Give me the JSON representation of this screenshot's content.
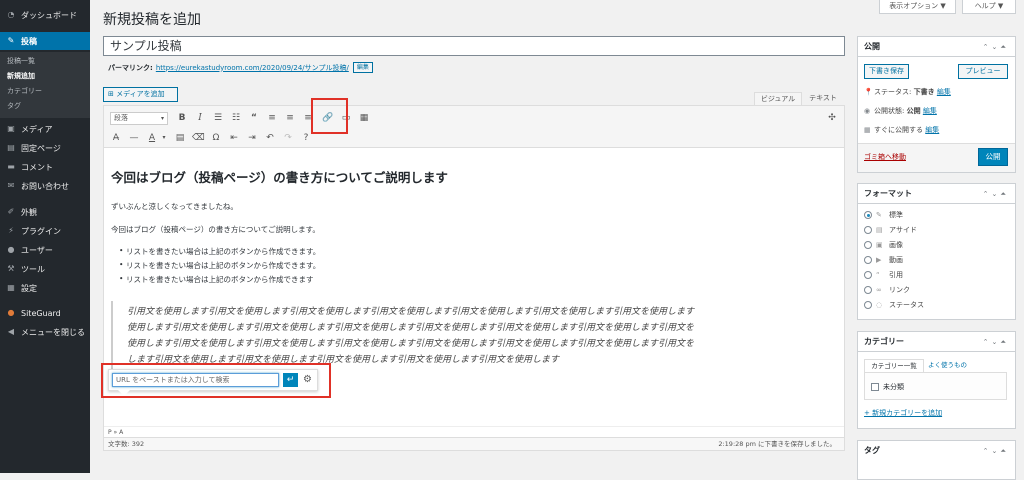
{
  "sidebar": {
    "items": [
      {
        "label": "ダッシュボード",
        "icon": "dashboard-icon"
      },
      {
        "label": "投稿",
        "icon": "pin-icon"
      },
      {
        "label": "メディア",
        "icon": "media-icon"
      },
      {
        "label": "固定ページ",
        "icon": "page-icon"
      },
      {
        "label": "コメント",
        "icon": "comment-icon"
      },
      {
        "label": "お問い合わせ",
        "icon": "mail-icon"
      },
      {
        "label": "外観",
        "icon": "brush-icon"
      },
      {
        "label": "プラグイン",
        "icon": "plugin-icon"
      },
      {
        "label": "ユーザー",
        "icon": "user-icon"
      },
      {
        "label": "ツール",
        "icon": "wrench-icon"
      },
      {
        "label": "設定",
        "icon": "settings-icon"
      },
      {
        "label": "SiteGuard",
        "icon": "siteguard-icon"
      },
      {
        "label": "メニューを閉じる",
        "icon": "collapse-icon"
      }
    ],
    "submenu": [
      "投稿一覧",
      "新規追加",
      "カテゴリー",
      "タグ"
    ]
  },
  "screen_options": "表示オプション ▼",
  "help": "ヘルプ ▼",
  "page_title": "新規投稿を追加",
  "post_title": "サンプル投稿",
  "permalink": {
    "label": "パーマリンク:",
    "url": "https://eurekastudyroom.com/2020/09/24/サンプル投稿/",
    "edit": "編集"
  },
  "add_media": "メディアを追加",
  "editor_tabs": {
    "visual": "ビジュアル",
    "text": "テキスト"
  },
  "toolbar": {
    "format": "段落"
  },
  "content": {
    "heading": "今回はブログ（投稿ページ）の書き方についてご説明します",
    "p1": "ずいぶんと涼しくなってきましたね。",
    "p2": "今回はブログ（投稿ページ）の書き方についてご説明します。",
    "list": [
      "リストを書きたい場合は上記のボタンから作成できます。",
      "リストを書きたい場合は上記のボタンから作成できます。",
      "リストを書きたい場合は上記のボタンから作成できます"
    ],
    "quote": [
      "引用文を使用します引用文を使用します引用文を使用します引用文を使用します引用文を使用します引用文を使用します引用文を使用します",
      "使用します引用文を使用します引用文を使用します引用文を使用します引用文を使用します引用文を使用します引用文を使用します引用文を",
      "使用します引用文を使用します引用文を使用します引用文を使用します引用文を使用します引用文を使用します引用文を使用します引用文を",
      "します引用文を使用します引用文を使用します引用文を使用します引用文を使用します引用文を使用します"
    ]
  },
  "link_popup": {
    "placeholder": "URL をペーストまたは入力して検索"
  },
  "statusbar": {
    "path": "P » A",
    "word_count": "文字数: 392",
    "saved": "2:19:28 pm に下書きを保存しました。"
  },
  "publish_box": {
    "title": "公開",
    "save_draft": "下書き保存",
    "preview": "プレビュー",
    "status_label": "ステータス:",
    "status_value": "下書き",
    "visibility_label": "公開状態:",
    "visibility_value": "公開",
    "schedule": "すぐに公開する",
    "edit": "編集",
    "trash": "ゴミ箱へ移動",
    "publish": "公開"
  },
  "format_box": {
    "title": "フォーマット",
    "options": [
      "標準",
      "アサイド",
      "画像",
      "動画",
      "引用",
      "リンク",
      "ステータス"
    ],
    "selected": "標準"
  },
  "category_box": {
    "title": "カテゴリー",
    "tab_all": "カテゴリー一覧",
    "tab_popular": "よく使うもの",
    "items": [
      "未分類"
    ],
    "add_new": "+ 新規カテゴリーを追加"
  },
  "tag_box": {
    "title": "タグ"
  },
  "colors": {
    "accent": "#0073aa",
    "sidebar": "#23282d",
    "highlight": "#e03127",
    "primary_button": "#0085ba"
  }
}
